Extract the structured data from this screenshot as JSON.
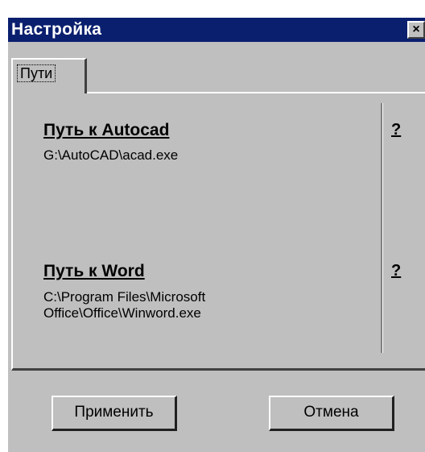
{
  "window": {
    "title": "Настройка",
    "close_glyph": "×"
  },
  "tabs": [
    {
      "label": "Пути",
      "selected": true
    }
  ],
  "paths": {
    "autocad": {
      "label": "Путь к Autocad",
      "value": "G:\\AutoCAD\\acad.exe",
      "help": "?"
    },
    "word": {
      "label": "Путь к Word",
      "value": "C:\\Program Files\\Microsoft\nOffice\\Office\\Winword.exe",
      "help": "?"
    }
  },
  "buttons": {
    "apply": "Применить",
    "cancel": "Отмена"
  },
  "colors": {
    "titlebar": "#0a1f6e",
    "face": "#bfbfbf"
  }
}
